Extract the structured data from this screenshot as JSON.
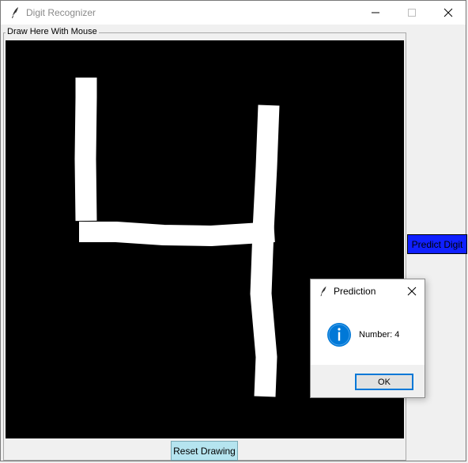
{
  "window": {
    "title": "Digit Recognizer",
    "icon": "feather-icon",
    "controls": [
      "minimize-icon",
      "maximize-icon",
      "close-icon"
    ]
  },
  "main": {
    "frame_label": "Draw Here With Mouse",
    "canvas": {
      "background": "#000000",
      "stroke_color": "#ffffff",
      "drawn_digit": "4"
    },
    "reset_button_label": "Reset Drawing",
    "predict_button_label": "Predict Digit"
  },
  "dialog": {
    "title": "Prediction",
    "icon": "info-icon",
    "message": "Number: 4",
    "ok_label": "OK"
  },
  "colors": {
    "reset_button_bg": "#b5e4ef",
    "predict_button_bg": "#1020ff",
    "info_icon": "#0078d7",
    "ok_button_border": "#0078d7"
  }
}
